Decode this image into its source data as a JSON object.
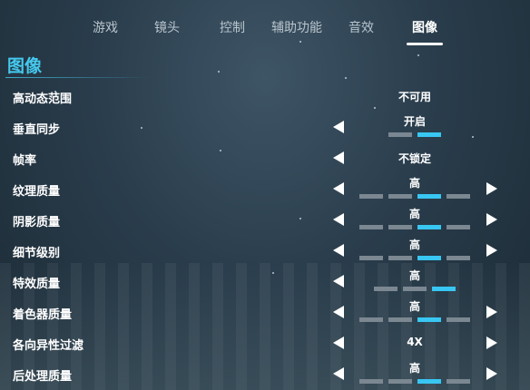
{
  "tabs": [
    {
      "label": "游戏",
      "active": false
    },
    {
      "label": "镜头",
      "active": false
    },
    {
      "label": "控制",
      "active": false
    },
    {
      "label": "辅助功能",
      "active": false
    },
    {
      "label": "音效",
      "active": false
    },
    {
      "label": "图像",
      "active": true
    }
  ],
  "section": {
    "title": "图像"
  },
  "settings": [
    {
      "label": "高动态范围",
      "value": "不可用",
      "has_left": false,
      "has_right": false,
      "levels": 0,
      "selected": 0
    },
    {
      "label": "垂直同步",
      "value": "开启",
      "has_left": true,
      "has_right": false,
      "levels": 2,
      "selected": 2
    },
    {
      "label": "帧率",
      "value": "不锁定",
      "has_left": true,
      "has_right": false,
      "levels": 0,
      "selected": 0
    },
    {
      "label": "纹理质量",
      "value": "高",
      "has_left": true,
      "has_right": true,
      "levels": 4,
      "selected": 3
    },
    {
      "label": "阴影质量",
      "value": "高",
      "has_left": true,
      "has_right": true,
      "levels": 4,
      "selected": 3
    },
    {
      "label": "细节级别",
      "value": "高",
      "has_left": true,
      "has_right": true,
      "levels": 4,
      "selected": 3
    },
    {
      "label": "特效质量",
      "value": "高",
      "has_left": true,
      "has_right": false,
      "levels": 3,
      "selected": 3
    },
    {
      "label": "着色器质量",
      "value": "高",
      "has_left": true,
      "has_right": true,
      "levels": 4,
      "selected": 3
    },
    {
      "label": "各向异性过滤",
      "value": "4X",
      "has_left": true,
      "has_right": true,
      "levels": 0,
      "selected": 0
    },
    {
      "label": "后处理质量",
      "value": "高",
      "has_left": true,
      "has_right": true,
      "levels": 4,
      "selected": 3
    }
  ],
  "colors": {
    "accent": "#38c6f2",
    "segment_off": "#7b8791",
    "title": "#45c9ee"
  }
}
